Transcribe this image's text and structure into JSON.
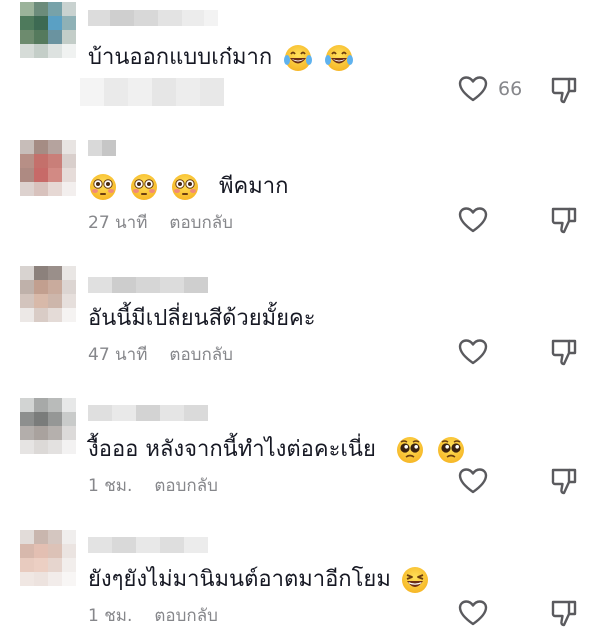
{
  "comments": [
    {
      "username_hidden": true,
      "text": "บ้านออกแบบเก๋มาก",
      "emojis": [
        "tears-of-joy",
        "tears-of-joy"
      ],
      "time": "",
      "reply_label": "",
      "like_count": "66"
    },
    {
      "username_hidden": true,
      "text": "พีคมาก",
      "emojis_before": [
        "flushed",
        "flushed",
        "flushed"
      ],
      "time": "27 นาที",
      "reply_label": "ตอบกลับ",
      "like_count": ""
    },
    {
      "username_hidden": true,
      "text": "อันนี้มีเปลี่ยนสีด้วยมั้ยคะ",
      "time": "47 นาที",
      "reply_label": "ตอบกลับ",
      "like_count": ""
    },
    {
      "username_hidden": true,
      "text": "งื้อออ หลังจากนี้ทำไงต่อคะเนี่ย",
      "emojis": [
        "pleading",
        "pleading"
      ],
      "time": "1 ชม.",
      "reply_label": "ตอบกลับ",
      "like_count": ""
    },
    {
      "username_hidden": true,
      "text": "ยังๆยังไม่มานิมนต์อาตมาอีกโยม",
      "emojis": [
        "grinning-squinting"
      ],
      "time": "1 ชม.",
      "reply_label": "ตอบกลับ",
      "like_count": ""
    }
  ],
  "icons": {
    "like": "heart-outline-icon",
    "dislike": "thumbs-down-outline-icon"
  },
  "colors": {
    "text": "#161823",
    "muted": "#86878b",
    "icon": "#5a5a5e",
    "background": "#ffffff"
  }
}
